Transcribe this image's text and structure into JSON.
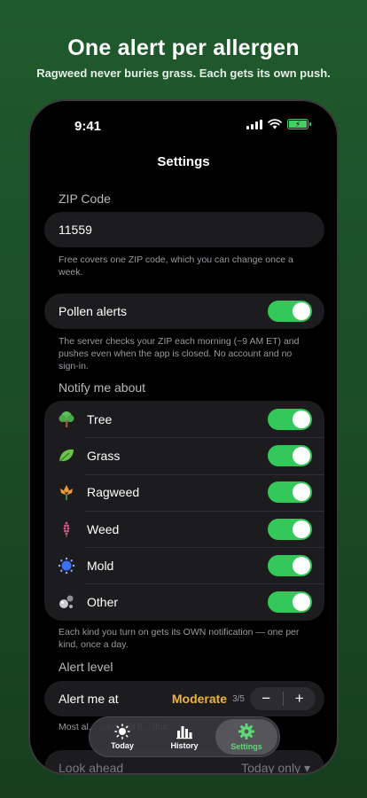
{
  "hero": {
    "title": "One alert per allergen",
    "subtitle": "Ragweed never buries grass. Each gets its own push."
  },
  "status_bar": {
    "time": "9:41"
  },
  "nav": {
    "title": "Settings"
  },
  "zip": {
    "label": "ZIP Code",
    "value": "11559",
    "note": "Free covers one ZIP code, which you can change once a week."
  },
  "pollen_alerts": {
    "label": "Pollen alerts",
    "enabled": true,
    "note": "The server checks your ZIP each morning (~9 AM ET) and pushes even when the app is closed. No account and no sign-in."
  },
  "notify": {
    "label": "Notify me about",
    "items": [
      {
        "label": "Tree",
        "icon": "tree-icon",
        "enabled": true
      },
      {
        "label": "Grass",
        "icon": "leaf-icon",
        "enabled": true
      },
      {
        "label": "Ragweed",
        "icon": "flower-icon",
        "enabled": true
      },
      {
        "label": "Weed",
        "icon": "weed-icon",
        "enabled": true
      },
      {
        "label": "Mold",
        "icon": "mold-icon",
        "enabled": true
      },
      {
        "label": "Other",
        "icon": "other-icon",
        "enabled": true
      }
    ],
    "note": "Each kind you turn on gets its OWN notification — one per kind, once a day."
  },
  "alert_level": {
    "label": "Alert level",
    "row_label": "Alert me at",
    "level": "Moderate",
    "fraction": "3/5",
    "minus": "−",
    "plus": "+",
    "note": "Most al... ...ers will fi... this."
  },
  "look_ahead": {
    "label": "Look ahead",
    "value": "Today only ▾"
  },
  "tabs": [
    {
      "label": "Today",
      "icon": "sun-icon",
      "active": false
    },
    {
      "label": "History",
      "icon": "chart-icon",
      "active": false
    },
    {
      "label": "Settings",
      "icon": "gear-icon",
      "active": true
    }
  ],
  "colors": {
    "accent_green": "#34c759",
    "level_amber": "#f0b43c",
    "background_green": "#1f5a2c"
  }
}
